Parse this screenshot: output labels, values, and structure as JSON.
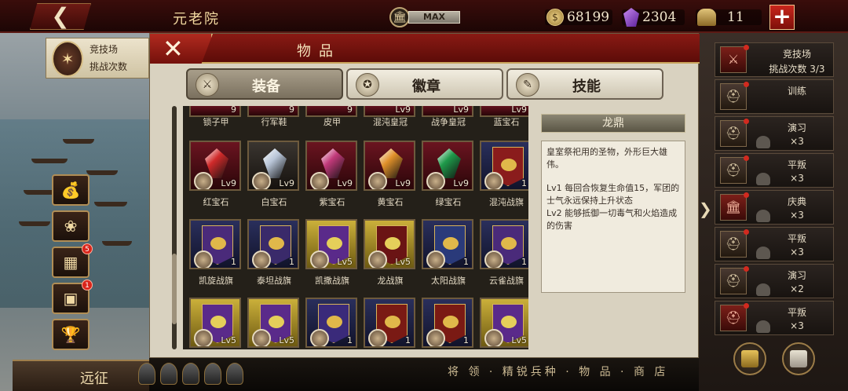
{
  "topbar": {
    "back_glyph": "❮",
    "title": "元老院",
    "max_label": "MAX",
    "gold": "68199",
    "gems": "2304",
    "helmets": "11",
    "plus_glyph": "+"
  },
  "left": {
    "arena_title": "竞技场",
    "arena_sub": "挑战次数",
    "badge_a": "5",
    "badge_b": "1",
    "expedition_label": "远征"
  },
  "dialog": {
    "title": "物品",
    "close_glyph": "✕",
    "tabs": [
      {
        "label": "装备",
        "active": true
      },
      {
        "label": "徽章",
        "active": false
      },
      {
        "label": "技能",
        "active": false
      }
    ]
  },
  "grid": {
    "top_row": [
      {
        "name": "锁子甲",
        "level": "9"
      },
      {
        "name": "行军鞋",
        "level": "9"
      },
      {
        "name": "皮甲",
        "level": "9"
      },
      {
        "name": "混沌皇冠",
        "level": "Lv9"
      },
      {
        "name": "战争皇冠",
        "level": "Lv9"
      },
      {
        "name": "蓝宝石",
        "level": "Lv9"
      }
    ],
    "row1": [
      {
        "name": "红宝石",
        "level": "Lv9",
        "color": "#d02a2a"
      },
      {
        "name": "白宝石",
        "level": "Lv9",
        "color": "#b9c6d8"
      },
      {
        "name": "紫宝石",
        "level": "Lv9",
        "color": "#c23a7a"
      },
      {
        "name": "黄宝石",
        "level": "Lv9",
        "color": "#e0902a"
      },
      {
        "name": "绿宝石",
        "level": "Lv9",
        "color": "#1f9a4a"
      },
      {
        "name": "混沌战旗",
        "level": "1",
        "color": "#8a1c1c"
      }
    ],
    "row2": [
      {
        "name": "凯旋战旗",
        "level": "1",
        "color": "#4a2a7a"
      },
      {
        "name": "泰坦战旗",
        "level": "1",
        "color": "#3a2a6a"
      },
      {
        "name": "凯撒战旗",
        "level": "Lv5",
        "color": "#5a2a8a"
      },
      {
        "name": "龙战旗",
        "level": "Lv5",
        "color": "#6a1414"
      },
      {
        "name": "太阳战旗",
        "level": "1",
        "color": "#2a3a7a"
      },
      {
        "name": "云雀战旗",
        "level": "1",
        "color": "#4a2a7a"
      }
    ],
    "row3": [
      {
        "name": "",
        "level": "Lv5",
        "color": "#5a2a8a"
      },
      {
        "name": "",
        "level": "Lv5",
        "color": "#5a2a8a"
      },
      {
        "name": "",
        "level": "1",
        "color": "#3a2a7a"
      },
      {
        "name": "",
        "level": "1",
        "color": "#7a1a14"
      },
      {
        "name": "",
        "level": "1",
        "color": "#7a1a14"
      },
      {
        "name": "",
        "level": "Lv5",
        "color": "#5a2a8a"
      }
    ]
  },
  "detail": {
    "title": "龙鼎",
    "desc": "皇室祭祀用的圣物，外形巨大雄伟。",
    "lv1": "Lv1 每回合恢复生命值15，军团的士气永远保持上升状态",
    "lv2": "Lv2 能够抵御一切毒气和火焰造成的伤害"
  },
  "bottom_menu": "将 领 · 精锐兵种 · 物 品 · 商 店",
  "tasks": [
    {
      "name": "竞技场",
      "count": "挑战次数 3/3",
      "icon": "⚔",
      "red": true
    },
    {
      "name": "训练",
      "count": "",
      "icon": "⛑",
      "red": false
    },
    {
      "name": "演习",
      "count": "×3",
      "icon": "⛑",
      "red": false
    },
    {
      "name": "平叛",
      "count": "×3",
      "icon": "⛑",
      "red": false
    },
    {
      "name": "庆典",
      "count": "×3",
      "icon": "🏛",
      "red": true
    },
    {
      "name": "平叛",
      "count": "×3",
      "icon": "⛑",
      "red": false
    },
    {
      "name": "演习",
      "count": "×2",
      "icon": "⛑",
      "red": false
    },
    {
      "name": "平叛",
      "count": "×3",
      "icon": "⛑",
      "red": true
    }
  ]
}
